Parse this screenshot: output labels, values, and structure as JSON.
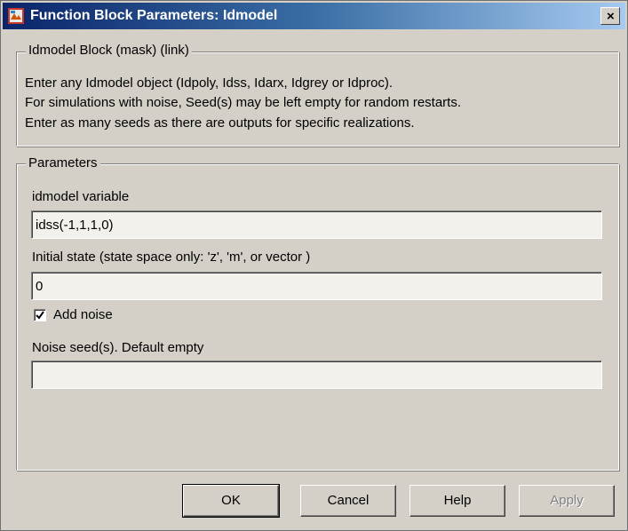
{
  "window": {
    "title": "Function Block Parameters: Idmodel",
    "close_label": "×",
    "title_icon": "simulink-block-icon",
    "accent": "#0a246a"
  },
  "description": {
    "group_label": "Idmodel Block (mask) (link)",
    "lines": [
      "Enter any Idmodel object (Idpoly, Idss, Idarx, Idgrey or Idproc).",
      "For simulations  with noise, Seed(s) may be left empty for random restarts.",
      "Enter as many seeds as there are outputs for specific realizations."
    ]
  },
  "parameters": {
    "group_label": "Parameters",
    "idmodel_label": "idmodel variable",
    "idmodel_value": "idss(-1,1,1,0)",
    "initial_state_label": "Initial state (state space only: 'z', 'm', or vector )",
    "initial_state_value": "0",
    "add_noise_label": "Add noise",
    "add_noise_checked": true,
    "noise_seed_label": "Noise seed(s).  Default empty",
    "noise_seed_value": ""
  },
  "buttons": {
    "ok": "OK",
    "cancel": "Cancel",
    "help": "Help",
    "apply": "Apply"
  }
}
